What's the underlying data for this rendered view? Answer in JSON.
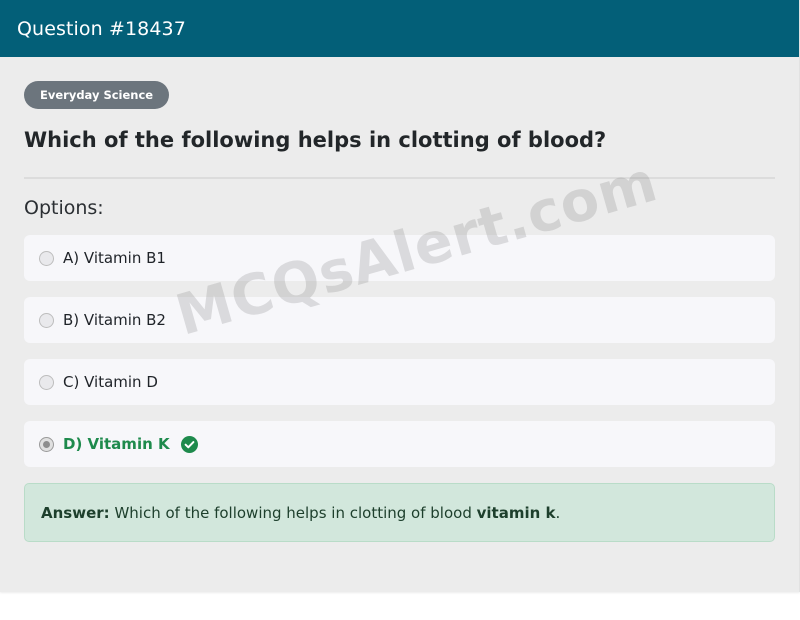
{
  "header": {
    "title": "Question #18437"
  },
  "category_badge": "Everyday Science",
  "question": "Which of the following helps in clotting of blood?",
  "options_label": "Options:",
  "options": [
    {
      "label": "A) Vitamin B1",
      "selected": false,
      "correct": false
    },
    {
      "label": "B) Vitamin B2",
      "selected": false,
      "correct": false
    },
    {
      "label": "C) Vitamin D",
      "selected": false,
      "correct": false
    },
    {
      "label": "D) Vitamin K",
      "selected": true,
      "correct": true
    }
  ],
  "answer": {
    "prefix": "Answer:",
    "text": "Which of the following helps in clotting of blood",
    "value": "vitamin k",
    "suffix": "."
  },
  "watermark": "MCQsAlert.com",
  "colors": {
    "header_bg": "#035f78",
    "badge_bg": "#6c757d",
    "correct": "#1e8a4c",
    "answer_bg": "#d2e7dc"
  },
  "icons": {
    "correct_option": "check-circle-icon"
  }
}
